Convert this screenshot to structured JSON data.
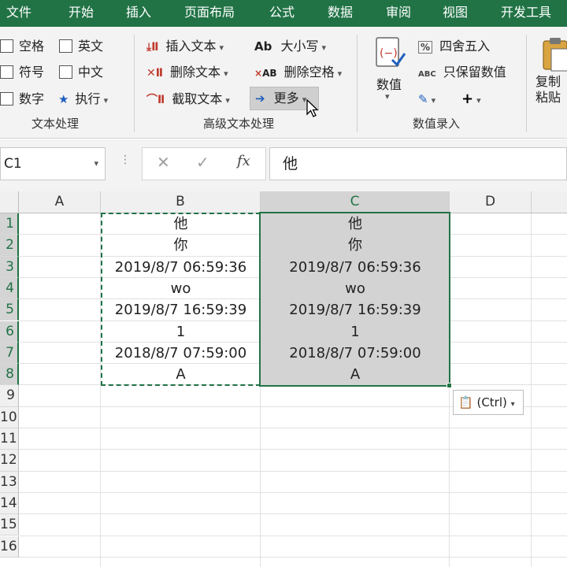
{
  "menu": [
    "文件",
    "开始",
    "插入",
    "页面布局",
    "公式",
    "数据",
    "审阅",
    "视图",
    "开发工具"
  ],
  "ribbon": {
    "text_group": {
      "label": "文本处理",
      "items": [
        "空格",
        "英文",
        "符号",
        "中文",
        "数字",
        "执行"
      ]
    },
    "adv_group": {
      "label": "高级文本处理",
      "insert_text": "插入文本",
      "delete_text": "删除文本",
      "extract_text": "截取文本",
      "case": "大小写",
      "delete_space": "删除空格",
      "more": "更多"
    },
    "num_group": {
      "label": "数值录入",
      "value": "数值",
      "round": "四舍五入",
      "keep_values": "只保留数值",
      "copy_paste": "复制粘贴"
    }
  },
  "formula_bar": {
    "name_box": "C1",
    "formula": "他"
  },
  "sheet": {
    "columns": [
      "A",
      "B",
      "C",
      "D"
    ],
    "rows": [
      "1",
      "2",
      "3",
      "4",
      "5",
      "6",
      "7",
      "8",
      "9",
      "10",
      "11",
      "12",
      "13",
      "14",
      "15",
      "16"
    ],
    "col_b": [
      "他",
      "你",
      "2019/8/7  06:59:36",
      "wo",
      "2019/8/7  16:59:39",
      "1",
      "2018/8/7  07:59:00",
      "A"
    ],
    "col_c": [
      "他",
      "你",
      "2019/8/7  06:59:36",
      "wo",
      "2019/8/7  16:59:39",
      "1",
      "2018/8/7  07:59:00",
      "A"
    ]
  },
  "paste_options": "(Ctrl)",
  "colors": {
    "accent": "#217346",
    "selection_fill": "#d3d3d3"
  }
}
